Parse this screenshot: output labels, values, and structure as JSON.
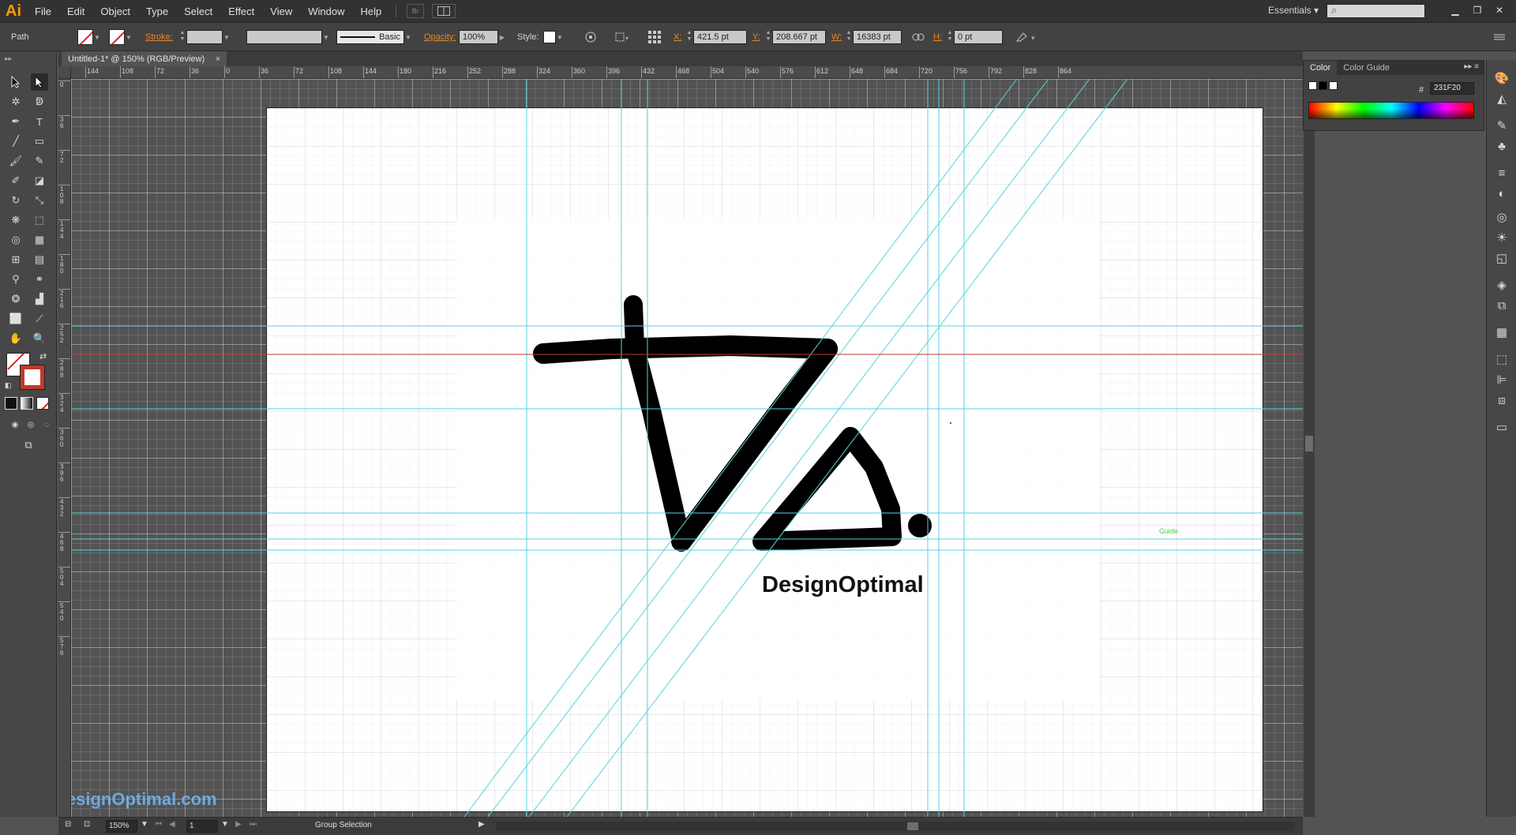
{
  "app": {
    "logo": "Ai",
    "menus": [
      "File",
      "Edit",
      "Object",
      "Type",
      "Select",
      "Effect",
      "View",
      "Window",
      "Help"
    ],
    "bridge_label": "Br",
    "workspace": "Essentials",
    "search_placeholder": ""
  },
  "control_bar": {
    "selection_type": "Path",
    "stroke_label": "Stroke:",
    "brush_style": "Basic",
    "opacity_label": "Opacity:",
    "opacity_value": "100%",
    "style_label": "Style:",
    "x_label": "X:",
    "x_value": "421.5 pt",
    "y_label": "Y:",
    "y_value": "208.667 pt",
    "w_label": "W:",
    "w_value": "16383 pt",
    "h_label": "H:",
    "h_value": "0 pt"
  },
  "document": {
    "tab_title": "Untitled-1* @ 150% (RGB/Preview)",
    "tab_close": "×",
    "artwork_text": "DesignOptimal",
    "guide_label": "Guide",
    "watermark": "DesignOptimal.com"
  },
  "rulers": {
    "horizontal": [
      "144",
      "108",
      "72",
      "36",
      "0",
      "36",
      "72",
      "108",
      "144",
      "180",
      "216",
      "252",
      "288",
      "324",
      "360",
      "396",
      "432",
      "468",
      "504",
      "540",
      "576",
      "612",
      "648",
      "684",
      "720",
      "756",
      "792",
      "828",
      "864"
    ],
    "vertical": [
      "0",
      "3 6",
      "7 2",
      "1 0 8",
      "1 4 4",
      "1 8 0",
      "2 1 6",
      "2 5 2",
      "2 8 8",
      "3 2 4",
      "3 6 0",
      "3 9 6",
      "4 3 2",
      "4 6 8",
      "5 0 4",
      "5 4 0",
      "5 7 6"
    ]
  },
  "status_bar": {
    "zoom": "150%",
    "page": "1",
    "status_text": "Group Selection"
  },
  "color_panel": {
    "tabs": [
      "Color",
      "Color Guide"
    ],
    "hex_label": "#",
    "hex_value": "231F20"
  },
  "colors": {
    "guide": "#57d3e0",
    "smart_guide": "#c0392b",
    "ink": "#000000",
    "accent": "#ff9a00"
  },
  "icons": {
    "tools": [
      "selection-tool-icon",
      "direct-selection-tool-icon",
      "magic-wand-icon",
      "lasso-icon",
      "pen-tool-icon",
      "type-tool-icon",
      "line-tool-icon",
      "rectangle-tool-icon",
      "paintbrush-icon",
      "pencil-icon",
      "blob-brush-icon",
      "eraser-icon",
      "rotate-icon",
      "scale-icon",
      "warp-icon",
      "free-transform-icon",
      "shape-builder-icon",
      "perspective-grid-icon",
      "mesh-icon",
      "gradient-icon",
      "eyedropper-icon",
      "blend-icon",
      "symbol-sprayer-icon",
      "column-graph-icon",
      "artboard-tool-icon",
      "slice-icon",
      "hand-tool-icon",
      "zoom-tool-icon"
    ]
  }
}
